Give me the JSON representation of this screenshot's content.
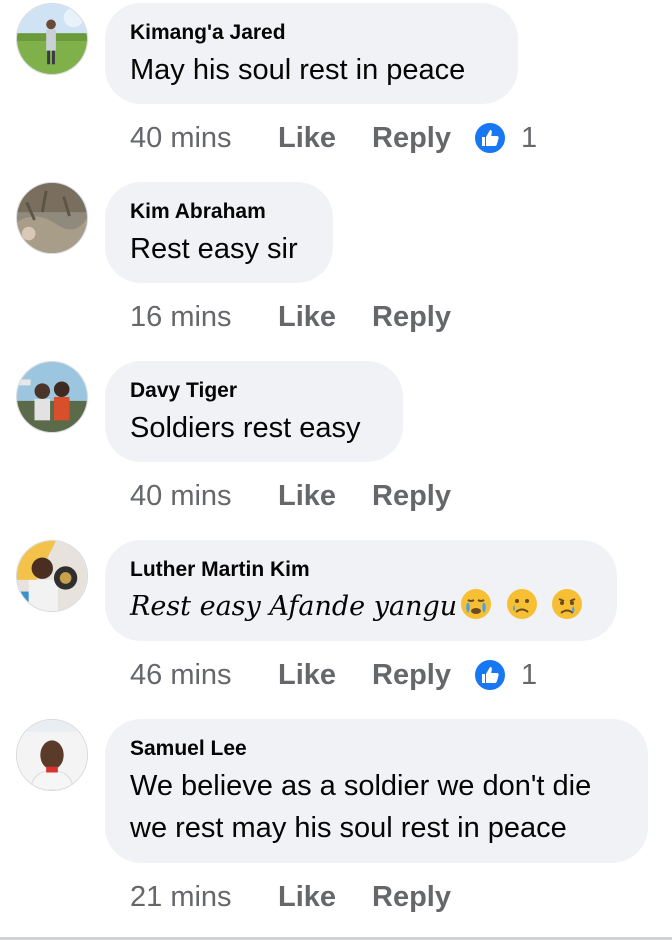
{
  "comments": [
    {
      "author": "Kimang'a Jared",
      "text": "May his soul rest in peace",
      "time": "40 mins",
      "like_label": "Like",
      "reply_label": "Reply",
      "reaction_count": "1"
    },
    {
      "author": "Kim Abraham",
      "text": "Rest easy sir",
      "time": "16 mins",
      "like_label": "Like",
      "reply_label": "Reply"
    },
    {
      "author": "Davy Tiger",
      "text": "Soldiers rest easy",
      "time": "40 mins",
      "like_label": "Like",
      "reply_label": "Reply"
    },
    {
      "author": "Luther Martin Kim",
      "text": "Rest easy Afande yangu",
      "emojis": [
        "crying-face-icon",
        "sad-tear-face-icon",
        "crying-face-icon"
      ],
      "time": "46 mins",
      "like_label": "Like",
      "reply_label": "Reply",
      "reaction_count": "1"
    },
    {
      "author": "Samuel Lee",
      "text_line1": "We believe as a soldier we don't die",
      "text_line2": "we rest may his soul rest in peace",
      "time": "21 mins",
      "like_label": "Like",
      "reply_label": "Reply"
    }
  ],
  "colors": {
    "bubble": "#f0f2f5",
    "meta_text": "#65676b",
    "like_reaction": "#1877f2"
  }
}
